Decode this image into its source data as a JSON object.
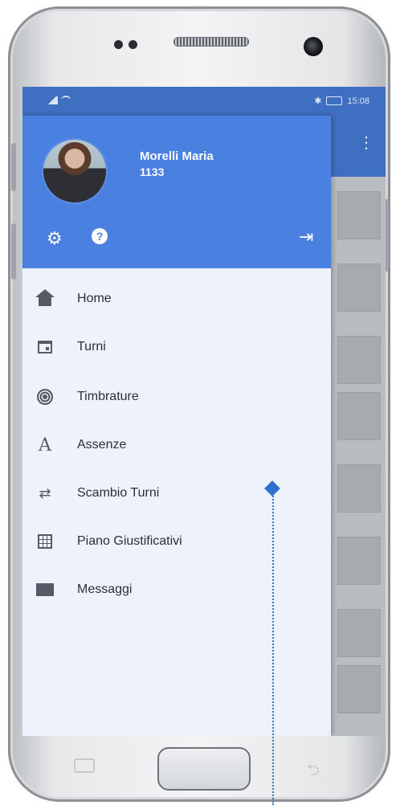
{
  "status_bar": {
    "time": "15:08",
    "battery_icon": "battery-icon",
    "bluetooth_icon": "bluetooth-icon"
  },
  "user": {
    "name": "Morelli Maria",
    "code": "1133"
  },
  "header_actions": [
    {
      "icon": "gear-icon"
    },
    {
      "icon": "help-icon",
      "glyph": "?"
    },
    {
      "icon": "logout-icon"
    }
  ],
  "menu": [
    {
      "label": "Home",
      "icon": "home-icon"
    },
    {
      "label": "Turni",
      "icon": "calendar-icon"
    },
    {
      "label": "Timbrature",
      "icon": "fingerprint-icon"
    },
    {
      "label": "Assenze",
      "icon": "letter-a-icon"
    },
    {
      "label": "Scambio Turni",
      "icon": "swap-icon"
    },
    {
      "label": "Piano Giustificativi",
      "icon": "grid-icon"
    },
    {
      "label": "Messaggi",
      "icon": "mail-icon"
    }
  ],
  "colors": {
    "primary": "#4a80df",
    "status_bar": "#3f6fc0",
    "drawer_bg": "#eef2fb",
    "marker": "#2f6fd0"
  }
}
